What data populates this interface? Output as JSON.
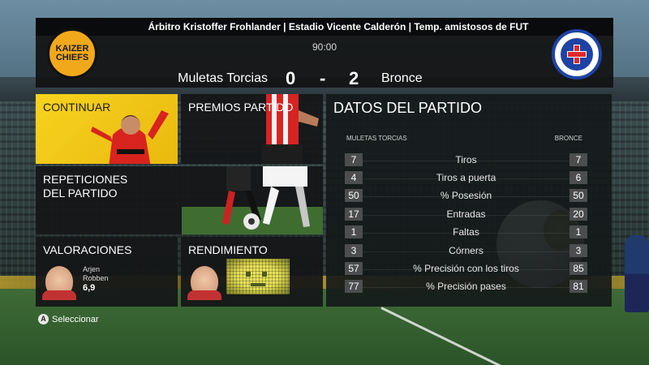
{
  "header": {
    "info_line": "Árbitro Kristoffer Frohlander | Estadio Vicente Calderón | Temp. amistosos de FUT",
    "match_time": "90:00",
    "home_team": "Muletas Torcias",
    "home_score": "0",
    "separator": "-",
    "away_score": "2",
    "away_team": "Bronce",
    "home_crest_text": "KAIZER CHIEFS"
  },
  "tiles": {
    "continue": "CONTINUAR",
    "awards": "PREMIOS PARTIDO",
    "replays_line1": "REPETICIONES",
    "replays_line2": "DEL PARTIDO",
    "ratings": "VALORACIONES",
    "performance": "RENDIMIENTO"
  },
  "player": {
    "first_name": "Arjen",
    "last_name": "Robben",
    "rating": "6,9"
  },
  "stats": {
    "title": "DATOS DEL PARTIDO",
    "home_label": "MULETAS TORCIAS",
    "away_label": "BRONCE",
    "rows": [
      {
        "name": "Tiros",
        "home": "7",
        "away": "7"
      },
      {
        "name": "Tiros a puerta",
        "home": "4",
        "away": "6"
      },
      {
        "name": "% Posesión",
        "home": "50",
        "away": "50"
      },
      {
        "name": "Entradas",
        "home": "17",
        "away": "20"
      },
      {
        "name": "Faltas",
        "home": "1",
        "away": "1"
      },
      {
        "name": "Córners",
        "home": "3",
        "away": "3"
      },
      {
        "name": "% Precisión con los tiros",
        "home": "57",
        "away": "85"
      },
      {
        "name": "% Precisión pases",
        "home": "77",
        "away": "81"
      }
    ]
  },
  "footer": {
    "button_glyph": "A",
    "hint": "Seleccionar"
  },
  "colors": {
    "continue_tile": "#f7d31e",
    "panel_bg": "#141618",
    "value_box": "#4b4d4f"
  }
}
